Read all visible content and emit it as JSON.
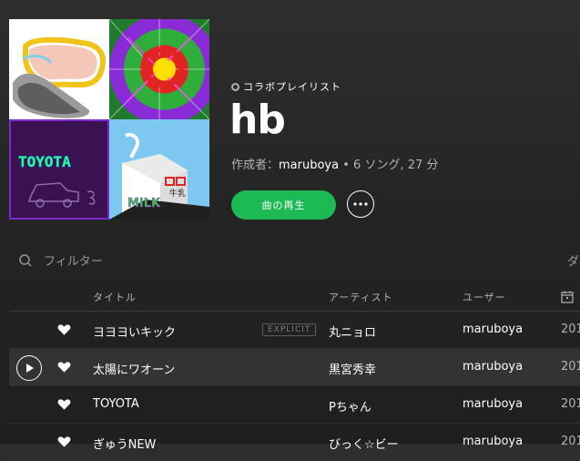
{
  "playlist": {
    "kind": "コラボプレイリスト",
    "title": "hb",
    "author_prefix": "作成者：",
    "owner": "maruboya",
    "stats": " • 6 ソング, 27 分"
  },
  "cover": {
    "toyota_text": "TOYOTA",
    "milk_text": "MILK",
    "carton_label": "牛乳"
  },
  "actions": {
    "play_label": "曲の再生",
    "more_label": "…"
  },
  "filter": {
    "placeholder": "フィルター",
    "right_label": "ダ"
  },
  "columns": {
    "title": "タイトル",
    "artist": "アーティスト",
    "user": "ユーザー"
  },
  "explicit_label": "EXPLICIT",
  "tracks": [
    {
      "title": "ヨヨヨいキック",
      "artist": "丸ニョロ",
      "user": "maruboya",
      "date": "201"
    },
    {
      "title": "太陽にワオーン",
      "artist": "黒宮秀幸",
      "user": "maruboya",
      "date": "201"
    },
    {
      "title": "TOYOTA",
      "artist": "Pちゃん",
      "user": "maruboya",
      "date": "201"
    },
    {
      "title": "ぎゅうNEW",
      "artist": "びっく☆ビー",
      "user": "maruboya",
      "date": "201"
    }
  ],
  "colors": {
    "accent": "#1db954",
    "background": "#242424"
  }
}
